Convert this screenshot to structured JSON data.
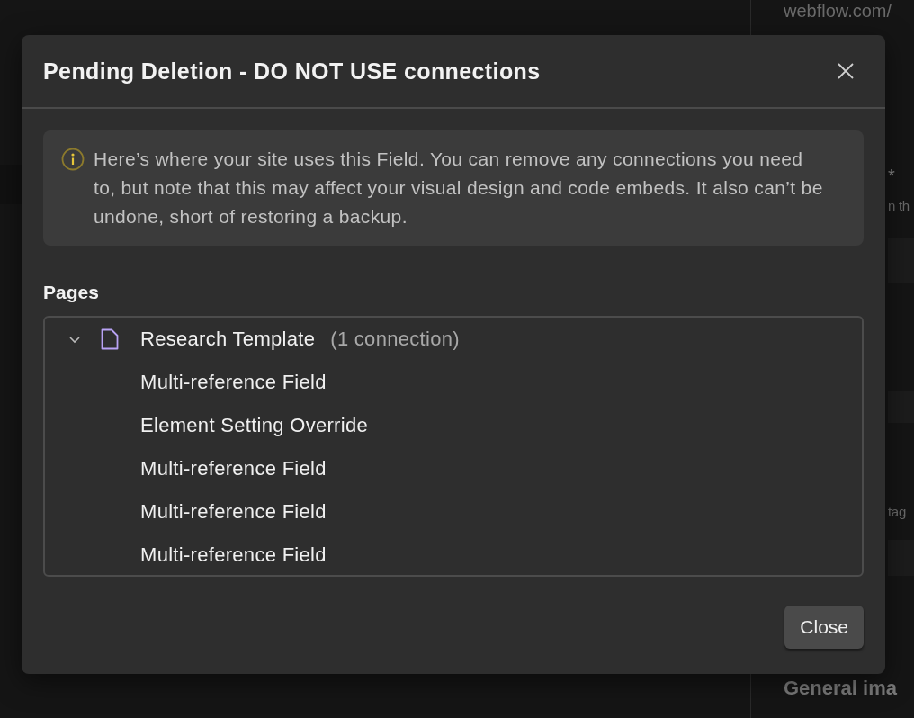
{
  "background": {
    "url_fragment": "webflow.com/",
    "required_mark": "*",
    "hint_fragment": "n th",
    "field_fragment": "tag",
    "section_fragment": "General ima"
  },
  "dialog": {
    "title": "Pending Deletion - DO NOT USE connections",
    "notice": "Here’s where your site uses this Field. You can remove any connections you need to, but note that this may affect your visual design and code embeds. It also can’t be undone, short of restoring a backup.",
    "section_title": "Pages",
    "tree": [
      {
        "label": "Research Template",
        "count": "(1 connection)",
        "expanded": true,
        "children": [
          {
            "label": "Multi-reference Field"
          },
          {
            "label": "Element Setting Override"
          },
          {
            "label": "Multi-reference Field"
          },
          {
            "label": "Multi-reference Field"
          },
          {
            "label": "Multi-reference Field"
          }
        ]
      }
    ],
    "buttons": [
      "Close"
    ]
  }
}
